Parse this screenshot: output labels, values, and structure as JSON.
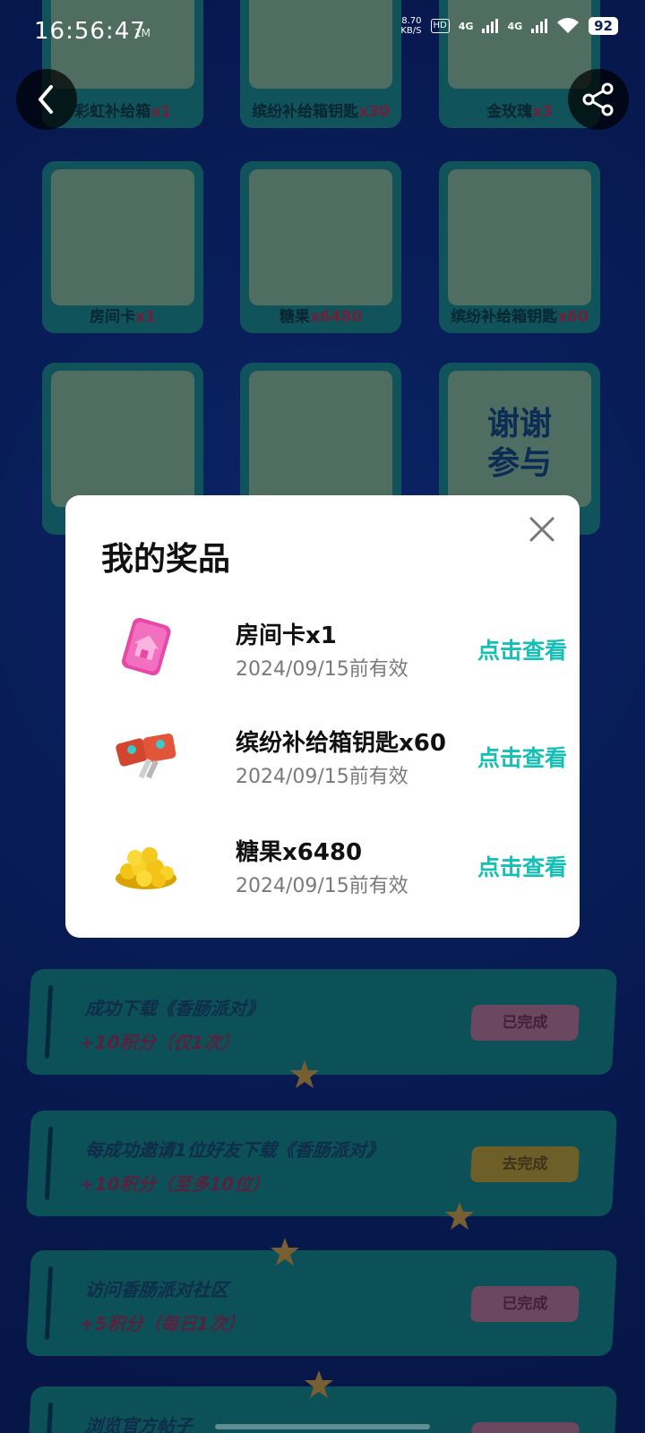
{
  "status_bar": {
    "time": "16:56:47",
    "tiny_icon": "1M",
    "net_speed_value": "8.70",
    "net_speed_unit": "KB/S",
    "hd": "HD",
    "signal_1": "4G",
    "signal_2": "4G",
    "battery": "92"
  },
  "nav": {
    "back_icon": "chevron-left-icon",
    "share_icon": "share-icon"
  },
  "prize_grid": {
    "row1": [
      {
        "name": "彩虹补给箱",
        "qty": "x1"
      },
      {
        "name": "缤纷补给箱钥匙",
        "qty": "x30"
      },
      {
        "name": "金玫瑰",
        "qty": "x3"
      }
    ],
    "row2": [
      {
        "name": "房间卡",
        "qty": "x1"
      },
      {
        "name": "糖果",
        "qty": "x6480"
      },
      {
        "name": "缤纷补给箱钥匙",
        "qty": "x60"
      }
    ],
    "thanks": [
      "谢谢",
      "参与"
    ]
  },
  "modal": {
    "title": "我的奖品",
    "items": [
      {
        "name": "房间卡x1",
        "valid": "2024/09/15前有效",
        "action": "点击查看"
      },
      {
        "name": "缤纷补给箱钥匙x60",
        "valid": "2024/09/15前有效",
        "action": "点击查看"
      },
      {
        "name": "糖果x6480",
        "valid": "2024/09/15前有效",
        "action": "点击查看"
      }
    ]
  },
  "tasks": [
    {
      "title": "成功下载《香肠派对》",
      "points": "+10积分（仅1次）",
      "status": "已完成"
    },
    {
      "title": "每成功邀请1位好友下载《香肠派对》",
      "points": "+10积分（至多10位）",
      "status": "去完成"
    },
    {
      "title": "访问香肠派对社区",
      "points": "+5积分（每日1次）",
      "status": "已完成"
    },
    {
      "title": "浏览官方帖子",
      "points": "",
      "status": ""
    }
  ],
  "colors": {
    "accent": "#14bfb6",
    "qty_red": "#c8324a",
    "card_teal": "#1e8f86"
  }
}
